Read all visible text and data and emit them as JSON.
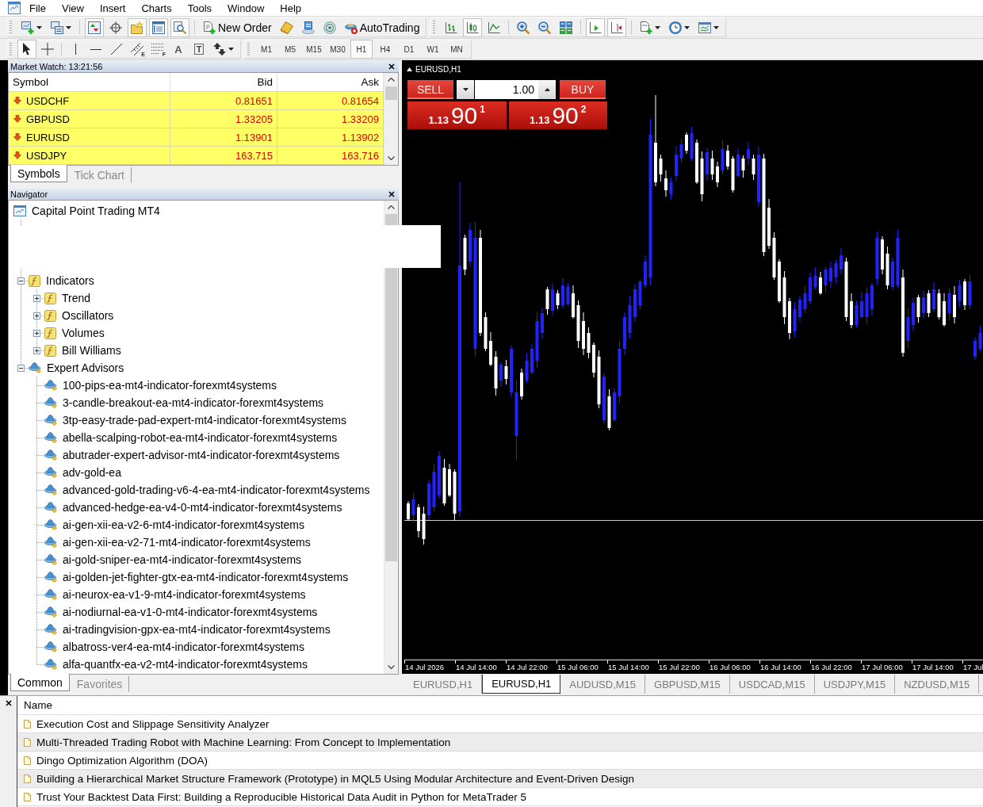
{
  "menu": [
    "File",
    "View",
    "Insert",
    "Charts",
    "Tools",
    "Window",
    "Help"
  ],
  "toolbar_rows": [
    {
      "toolbars": [
        {
          "groups": [
            [
              {
                "kind": "new-chart",
                "on": false,
                "dropdown": true
              },
              {
                "kind": "profiles",
                "on": false,
                "dropdown": true
              }
            ],
            [
              {
                "kind": "market-watch",
                "on": true,
                "dropdown": false
              },
              {
                "kind": "data-window",
                "on": false,
                "dropdown": false
              },
              {
                "kind": "navigator",
                "on": true,
                "dropdown": false
              },
              {
                "kind": "terminal",
                "on": true,
                "dropdown": false
              },
              {
                "kind": "tester",
                "on": true,
                "dropdown": false
              }
            ],
            [
              {
                "kind": "new-order",
                "label": "New Order",
                "on": false,
                "dropdown": false
              },
              {
                "kind": "metaeditor",
                "on": false,
                "dropdown": false
              },
              {
                "kind": "market",
                "on": false,
                "dropdown": false
              },
              {
                "kind": "signals",
                "on": false,
                "dropdown": false
              },
              {
                "kind": "autotrading",
                "label": "AutoTrading",
                "on": false,
                "dropdown": false
              }
            ]
          ]
        },
        {
          "groups": [
            [
              {
                "kind": "bar-chart",
                "on": false,
                "dropdown": false
              },
              {
                "kind": "candles",
                "on": true,
                "dropdown": false
              },
              {
                "kind": "line-chart",
                "on": false,
                "dropdown": false
              }
            ],
            [
              {
                "kind": "zoom-in",
                "on": false,
                "dropdown": false
              },
              {
                "kind": "zoom-out",
                "on": false,
                "dropdown": false
              },
              {
                "kind": "tile",
                "on": false,
                "dropdown": false
              }
            ],
            [
              {
                "kind": "auto-scroll",
                "on": true,
                "dropdown": false
              },
              {
                "kind": "chart-shift",
                "on": true,
                "dropdown": false
              }
            ],
            [
              {
                "kind": "indicators",
                "on": false,
                "dropdown": true
              },
              {
                "kind": "periods",
                "on": false,
                "dropdown": true
              },
              {
                "kind": "templates",
                "on": false,
                "dropdown": true
              }
            ]
          ]
        }
      ]
    },
    {
      "toolbars": [
        {
          "groups": [
            [
              {
                "kind": "cursor",
                "selected": true,
                "dropdown": false
              },
              {
                "kind": "crosshair",
                "selected": false,
                "dropdown": false
              }
            ],
            [
              {
                "kind": "vline",
                "selected": false,
                "dropdown": false
              },
              {
                "kind": "hline",
                "selected": false,
                "dropdown": false
              },
              {
                "kind": "trendline",
                "selected": false,
                "dropdown": false
              },
              {
                "kind": "channel",
                "glyph": "E",
                "selected": false,
                "dropdown": false
              },
              {
                "kind": "fibo",
                "glyph": "F",
                "selected": false,
                "dropdown": false
              },
              {
                "kind": "text",
                "glyph": "A",
                "selected": false,
                "dropdown": false
              },
              {
                "kind": "label",
                "glyph": "T",
                "selected": false,
                "dropdown": false
              },
              {
                "kind": "arrows",
                "selected": false,
                "dropdown": true
              }
            ]
          ]
        },
        {
          "groups": [
            [
              {
                "kind": "period",
                "label": "M1",
                "selected": false,
                "dropdown": false
              },
              {
                "kind": "period",
                "label": "M5",
                "selected": false,
                "dropdown": false
              },
              {
                "kind": "period",
                "label": "M15",
                "selected": false,
                "dropdown": false
              },
              {
                "kind": "period",
                "label": "M30",
                "selected": false,
                "dropdown": false
              },
              {
                "kind": "period",
                "label": "H1",
                "selected": true,
                "dropdown": false
              },
              {
                "kind": "period",
                "label": "H4",
                "selected": false,
                "dropdown": false
              },
              {
                "kind": "period",
                "label": "D1",
                "selected": false,
                "dropdown": false
              },
              {
                "kind": "period",
                "label": "W1",
                "selected": false,
                "dropdown": false
              },
              {
                "kind": "period",
                "label": "MN",
                "selected": false,
                "dropdown": false
              }
            ]
          ]
        }
      ]
    }
  ],
  "market_watch": {
    "title": "Market Watch: 13:21:56",
    "columns": [
      "Symbol",
      "Bid",
      "Ask"
    ],
    "rows": [
      {
        "symbol": "USDCHF",
        "bid": "0.81651",
        "ask": "0.81654",
        "falling": true
      },
      {
        "symbol": "GBPUSD",
        "bid": "1.33205",
        "ask": "1.33209",
        "falling": true
      },
      {
        "symbol": "EURUSD",
        "bid": "1.13901",
        "ask": "1.13902",
        "falling": true
      },
      {
        "symbol": "USDJPY",
        "bid": "163.715",
        "ask": "163.716",
        "falling": true
      }
    ],
    "tabs": [
      {
        "label": "Symbols",
        "selected": true
      },
      {
        "label": "Tick Chart",
        "selected": false
      }
    ]
  },
  "navigator": {
    "title": "Navigator",
    "tree": [
      {
        "label": "Capital Point Trading MT4",
        "kind": "terminal",
        "children": [
          {
            "label": "Indicators",
            "kind": "indicator-folder",
            "expanded": true,
            "children": [
              {
                "label": "Trend",
                "kind": "indicator-folder",
                "expanded": false
              },
              {
                "label": "Oscillators",
                "kind": "indicator-folder",
                "expanded": false
              },
              {
                "label": "Volumes",
                "kind": "indicator-folder",
                "expanded": false
              },
              {
                "label": "Bill Williams",
                "kind": "indicator-folder",
                "expanded": false
              }
            ]
          },
          {
            "label": "Expert Advisors",
            "kind": "experts",
            "expanded": true,
            "children": [
              {
                "label": "100-pips-ea-mt4-indicator-forexmt4systems",
                "kind": "expert"
              },
              {
                "label": "3-candle-breakout-ea-mt4-indicator-forexmt4systems",
                "kind": "expert"
              },
              {
                "label": "3tp-easy-trade-pad-expert-mt4-indicator-forexmt4systems",
                "kind": "expert"
              },
              {
                "label": "abella-scalping-robot-ea-mt4-indicator-forexmt4systems",
                "kind": "expert"
              },
              {
                "label": "abutrader-expert-advisor-mt4-indicator-forexmt4systems",
                "kind": "expert"
              },
              {
                "label": "adv-gold-ea",
                "kind": "expert"
              },
              {
                "label": "advanced-gold-trading-v6-4-ea-mt4-indicator-forexmt4systems",
                "kind": "expert"
              },
              {
                "label": "advanced-hedge-ea-v4-0-mt4-indicator-forexmt4systems",
                "kind": "expert"
              },
              {
                "label": "ai-gen-xii-ea-v2-6-mt4-indicator-forexmt4systems",
                "kind": "expert"
              },
              {
                "label": "ai-gen-xii-ea-v2-71-mt4-indicator-forexmt4systems",
                "kind": "expert"
              },
              {
                "label": "ai-gold-sniper-ea-mt4-indicator-forexmt4systems",
                "kind": "expert"
              },
              {
                "label": "ai-golden-jet-fighter-gtx-ea-mt4-indicator-forexmt4systems",
                "kind": "expert"
              },
              {
                "label": "ai-neurox-ea-v1-9-mt4-indicator-forexmt4systems",
                "kind": "expert"
              },
              {
                "label": "ai-nodiurnal-ea-v1-0-mt4-indicator-forexmt4systems",
                "kind": "expert"
              },
              {
                "label": "ai-tradingvision-gpx-ea-mt4-indicator-forexmt4systems",
                "kind": "expert"
              },
              {
                "label": "albatross-ver4-ea-mt4-indicator-forexmt4systems",
                "kind": "expert"
              },
              {
                "label": "alfa-quantfx-ea-v2-mt4-indicator-forexmt4systems",
                "kind": "expert"
              }
            ]
          }
        ]
      }
    ],
    "tabs": [
      {
        "label": "Common",
        "selected": true
      },
      {
        "label": "Favorites",
        "selected": false
      }
    ]
  },
  "chart": {
    "title": "EURUSD,H1",
    "trade_panel": {
      "sell": "SELL",
      "buy": "BUY",
      "volume": "1.00",
      "sell_price": {
        "big": "1.13",
        "pips": "90",
        "point": "1"
      },
      "buy_price": {
        "big": "1.13",
        "pips": "90",
        "point": "2"
      }
    },
    "time_axis": [
      "14 Jul 2026",
      "14 Jul 14:00",
      "14 Jul 22:00",
      "15 Jul 06:00",
      "15 Jul 14:00",
      "15 Jul 22:00",
      "16 Jul 06:00",
      "16 Jul 14:00",
      "16 Jul 22:00",
      "17 Jul 06:00",
      "17 Jul 14:00",
      "17 Jul"
    ],
    "tabs": [
      {
        "label": "EURUSD,H1",
        "selected": false
      },
      {
        "label": "EURUSD,H1",
        "selected": true
      },
      {
        "label": "AUDUSD,M15",
        "selected": false
      },
      {
        "label": "GBPUSD,M15",
        "selected": false
      },
      {
        "label": "USDCAD,M15",
        "selected": false
      },
      {
        "label": "USDJPY,M15",
        "selected": false
      },
      {
        "label": "NZDUSD,M15",
        "selected": false
      }
    ]
  },
  "articles": {
    "column": "Name",
    "rows": [
      "Execution Cost and Slippage Sensitivity Analyzer",
      "Multi-Threaded Trading Robot with Machine Learning: From Concept to Implementation",
      "Dingo Optimization Algorithm (DOA)",
      "Building a Hierarchical Market Structure Framework (Prototype) in MQL5 Using Modular Architecture and Event-Driven Design",
      "Trust Your Backtest Data First: Building a Reproducible Historical Data Audit in Python for MetaTrader 5"
    ]
  }
}
